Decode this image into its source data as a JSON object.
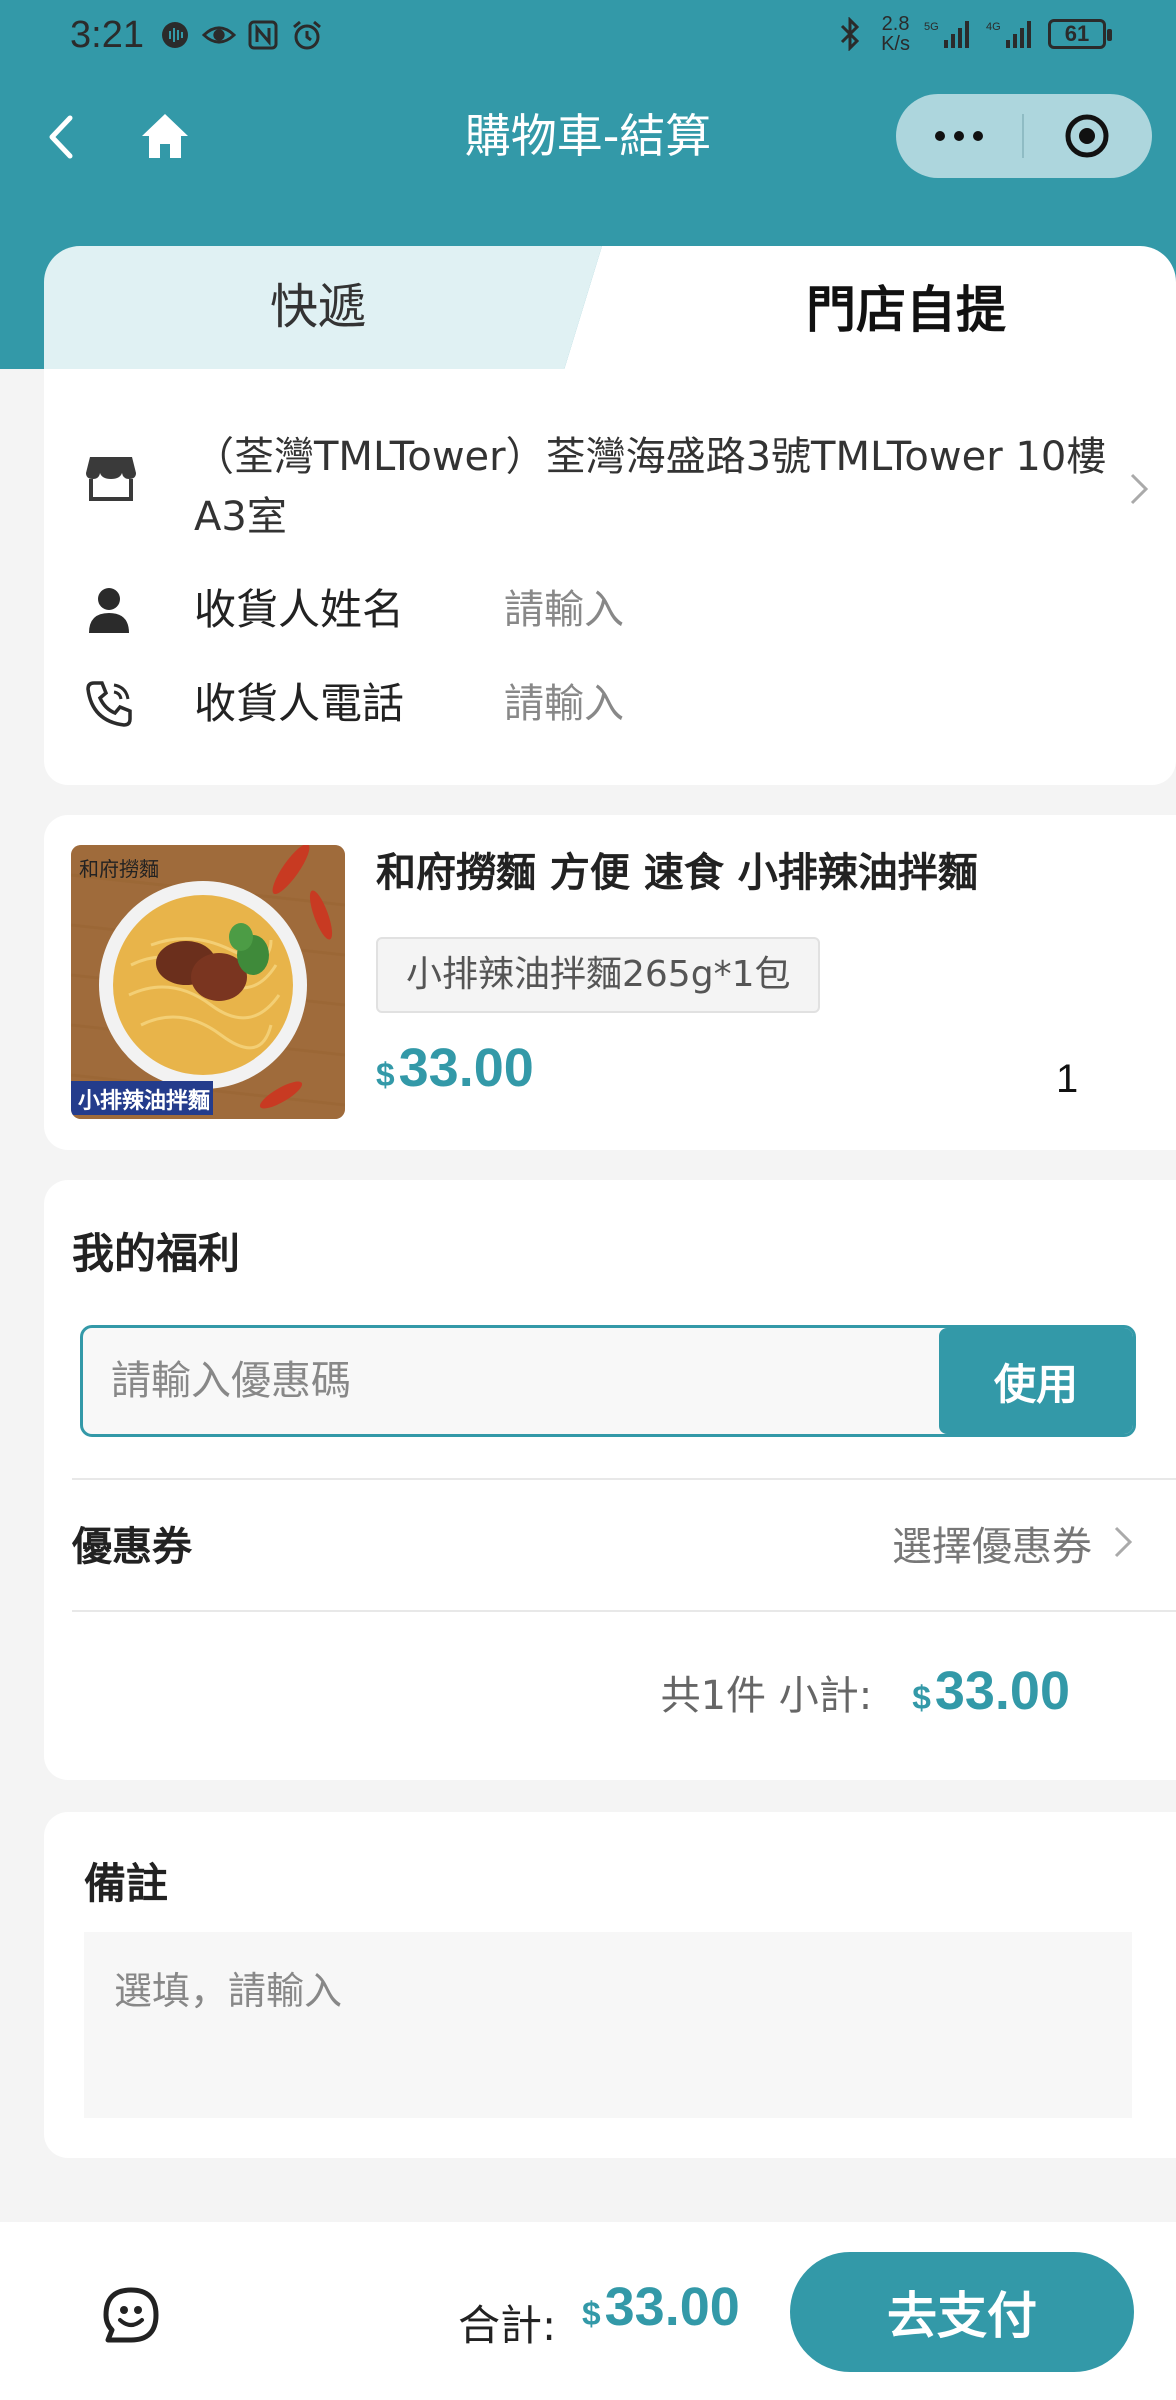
{
  "status_bar": {
    "time": "3:21",
    "net_speed_value": "2.8",
    "net_speed_unit": "K/s",
    "signal_1": "5G",
    "signal_2": "4G",
    "battery": "61"
  },
  "header": {
    "title": "購物車-結算",
    "accent_color": "#3399a8"
  },
  "tabs": [
    {
      "label": "快遞",
      "active": false
    },
    {
      "label": "門店自提",
      "active": true
    }
  ],
  "pickup": {
    "store_address": "（荃灣TMLTower）荃灣海盛路3號TMLTower 10樓A3室",
    "receiver_name_label": "收貨人姓名",
    "receiver_name_placeholder": "請輸入",
    "receiver_phone_label": "收貨人電話",
    "receiver_phone_placeholder": "請輸入"
  },
  "product": {
    "name": "和府撈麵 方便 速食 小排辣油拌麵",
    "spec": "小排辣油拌麵265g*1包",
    "currency": "$",
    "price": "33.00",
    "quantity": "1",
    "image_caption": "小排辣油拌麵",
    "image_logo_text": "和府撈麵"
  },
  "benefits": {
    "title": "我的福利",
    "coupon_code_placeholder": "請輸入優惠碼",
    "use_button": "使用",
    "voucher_label": "優惠券",
    "voucher_select": "選擇優惠券",
    "subtotal_label": "共1件 小計:",
    "subtotal_currency": "$",
    "subtotal_value": "33.00"
  },
  "notes": {
    "title": "備註",
    "placeholder": "選填，請輸入"
  },
  "footer": {
    "total_label": "合計:",
    "total_currency": "$",
    "total_value": "33.00",
    "pay_button": "去支付"
  }
}
